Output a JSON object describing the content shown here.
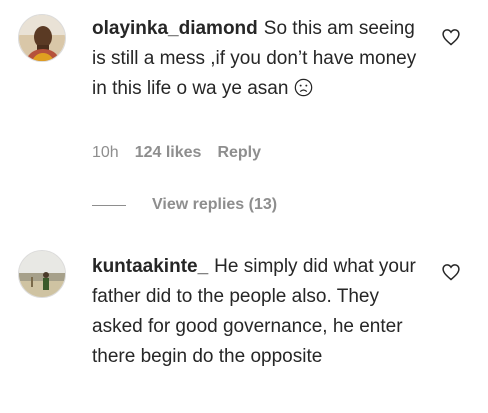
{
  "comments": [
    {
      "username": "olayinka_diamond",
      "text": "So this am seeing is still a mess ,if you don’t have money in this life o wa ye asan",
      "emoji": "frowning-face",
      "time": "10h",
      "likes": "124 likes",
      "reply_label": "Reply",
      "view_replies": "View replies (13)"
    },
    {
      "username": "kuntaakinte_",
      "text": "He simply did what your father did to the people also. They asked for good governance, he enter there begin do the opposite"
    }
  ]
}
